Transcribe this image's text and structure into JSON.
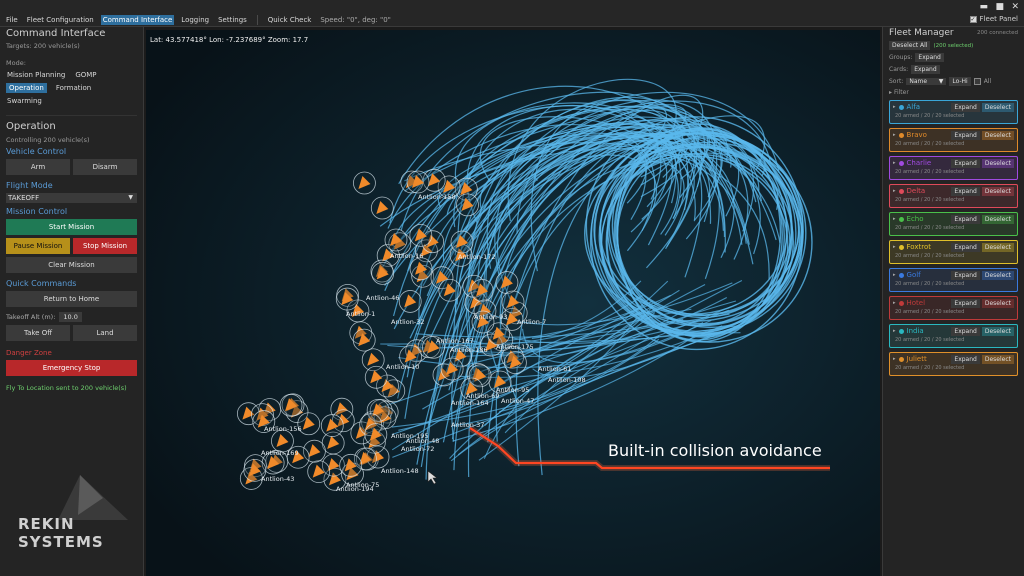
{
  "window": {
    "minimize": "▬",
    "maximize": "■",
    "close": "✕"
  },
  "menubar": {
    "items": [
      "File",
      "Fleet Configuration",
      "Command Interface",
      "Logging",
      "Settings"
    ],
    "active_index": 2,
    "quick_check": "Quick Check",
    "speed": "Speed: \"0\", deg: \"0\"",
    "fleet_panel": "Fleet Panel",
    "fleet_panel_checked": true
  },
  "left": {
    "title": "Command Interface",
    "targets": "Targets: 200 vehicle(s)",
    "mode_label": "Mode:",
    "modes": [
      "Mission Planning",
      "GOMP",
      "Operation",
      "Formation",
      "Swarming"
    ],
    "active_mode_index": 2,
    "section": "Operation",
    "controlling": "Controlling 200 vehicle(s)",
    "vehicle_control": "Vehicle Control",
    "arm": "Arm",
    "disarm": "Disarm",
    "flight_mode_label": "Flight Mode",
    "flight_mode": "TAKEOFF",
    "mission_control": "Mission Control",
    "start_mission": "Start Mission",
    "pause_mission": "Pause Mission",
    "stop_mission": "Stop Mission",
    "clear_mission": "Clear Mission",
    "quick_commands": "Quick Commands",
    "return_home": "Return to Home",
    "takeoff_alt_label": "Takeoff Alt (m):",
    "takeoff_alt": "10.0",
    "take_off": "Take Off",
    "land": "Land",
    "danger_zone": "Danger Zone",
    "emergency_stop": "Emergency Stop",
    "status": "Fly To Location sent to 200 vehicle(s)"
  },
  "logo": {
    "line1": "REKIN",
    "line2": "SYSTEMS"
  },
  "map": {
    "coords": "Lat: 43.577418° Lon: -7.237689° Zoom: 17.7",
    "annotation": "Built-in collision avoidance",
    "drone_labels": [
      "Antlion-158",
      "Antlion-16",
      "Antlion-172",
      "Antlion-46",
      "Antlion-1",
      "Antlion-32",
      "Antlion-93",
      "Antlion-7",
      "Antlion-167",
      "Antlion-175",
      "Antlion-10",
      "Antlion-186",
      "Antlion-61",
      "Antlion-108",
      "Antlion-95",
      "Antlion-69",
      "Antlion-164",
      "Antlion-47",
      "Antlion-37",
      "Antlion-48",
      "Antlion-195",
      "Antlion-72",
      "Antlion-156",
      "Antlion-169",
      "Antlion-148",
      "Antlion-43",
      "Antlion-75",
      "Antlion-194"
    ],
    "colors": {
      "trail": "#5ab8ec",
      "drone": "#f08a2a",
      "annotation_line": "#ff3a1a"
    }
  },
  "right": {
    "title": "Fleet Manager",
    "connected": "200 connected",
    "deselect_all": "Deselect All",
    "selected": "(200 selected)",
    "groups_label": "Groups:",
    "cards_label": "Cards:",
    "expand": "Expand",
    "sort_label": "Sort:",
    "sort_value": "Name",
    "lohi": "Lo-Hi",
    "all": "All",
    "filter": "Filter",
    "group_expand": "Expand",
    "group_deselect": "Deselect",
    "groups": [
      {
        "name": "Alfa",
        "sub": "20 armed / 20 / 20 selected",
        "color": "#3aa6d8"
      },
      {
        "name": "Bravo",
        "sub": "20 armed / 20 / 20 selected",
        "color": "#e08a2a"
      },
      {
        "name": "Charlie",
        "sub": "20 armed / 20 / 20 selected",
        "color": "#a04ae0"
      },
      {
        "name": "Delta",
        "sub": "20 armed / 20 / 20 selected",
        "color": "#e04a5a"
      },
      {
        "name": "Echo",
        "sub": "20 armed / 20 / 20 selected",
        "color": "#4ac04a"
      },
      {
        "name": "Foxtrot",
        "sub": "20 armed / 20 / 20 selected",
        "color": "#e0c02a"
      },
      {
        "name": "Golf",
        "sub": "20 armed / 20 / 20 selected",
        "color": "#3a7ae0"
      },
      {
        "name": "Hotel",
        "sub": "20 armed / 20 / 20 selected",
        "color": "#c03a3a"
      },
      {
        "name": "India",
        "sub": "20 armed / 20 / 20 selected",
        "color": "#2ab8c0"
      },
      {
        "name": "Juliett",
        "sub": "20 armed / 20 / 20 selected",
        "color": "#e0902a"
      }
    ]
  }
}
